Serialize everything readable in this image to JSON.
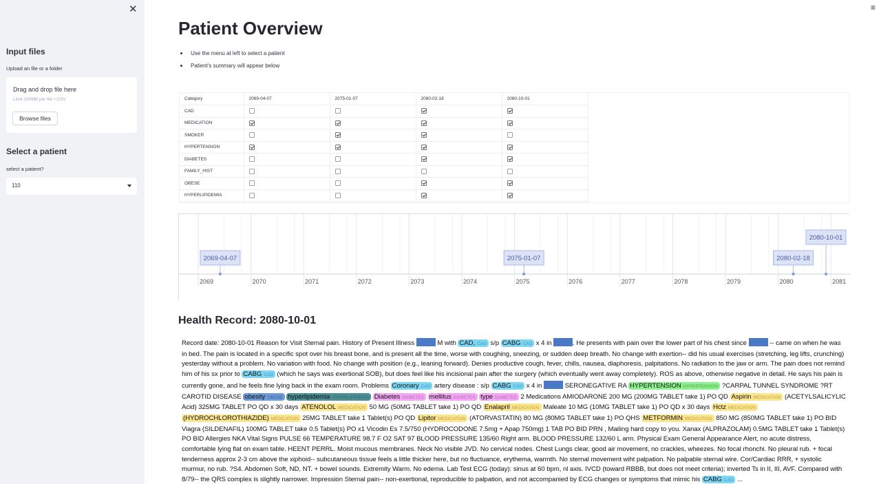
{
  "sidebar": {
    "input_files_title": "Input files",
    "upload_label": "Upload an file or a folder",
    "uploader_title": "Drag and drop file here",
    "uploader_limit": "Limit 200MB per file • CSV",
    "browse_label": "Browse files",
    "select_title": "Select a patient",
    "select_label": "select a patient?",
    "selected_patient": "110",
    "close_glyph": "✕"
  },
  "menu_glyph": "≡",
  "page": {
    "title": "Patient Overview",
    "bullets": [
      "Use the menu at left to select a patient",
      "Patient's summary will appear below"
    ]
  },
  "table": {
    "headers": [
      "Category",
      "2069-04-07",
      "2075-01-07",
      "2080-02-18",
      "2080-10-01"
    ],
    "rows": [
      {
        "category": "CAD",
        "values": [
          false,
          false,
          true,
          true
        ]
      },
      {
        "category": "MEDICATION",
        "values": [
          true,
          true,
          true,
          true
        ]
      },
      {
        "category": "SMOKER",
        "values": [
          false,
          true,
          true,
          false
        ]
      },
      {
        "category": "HYPERTENSION",
        "values": [
          true,
          true,
          true,
          true
        ]
      },
      {
        "category": "DIABETES",
        "values": [
          false,
          false,
          true,
          true
        ]
      },
      {
        "category": "FAMILY_HIST",
        "values": [
          false,
          false,
          false,
          false
        ]
      },
      {
        "category": "OBESE",
        "values": [
          false,
          false,
          true,
          true
        ]
      },
      {
        "category": "HYPERLIPIDEMIA",
        "values": [
          false,
          false,
          true,
          true
        ]
      }
    ]
  },
  "timeline": {
    "years": [
      "2069",
      "2070",
      "2071",
      "2072",
      "2073",
      "2074",
      "2075",
      "2076",
      "2077",
      "2078",
      "2079",
      "2080",
      "2081"
    ],
    "events": [
      {
        "label": "2069-04-07",
        "year": 2069.26
      },
      {
        "label": "2075-01-07",
        "year": 2075.02
      },
      {
        "label": "2080-02-18",
        "year": 2080.13
      },
      {
        "label": "2080-10-01",
        "year": 2080.75
      }
    ],
    "colors": {
      "box_fill": "#dde3f7",
      "box_stroke": "#aab8ec",
      "box_text": "#4a5aa8",
      "point": "#7e95e0"
    }
  },
  "record": {
    "title": "Health Record: 2080-10-01",
    "segments": [
      {
        "t": "Record date: 2080-10-01 Reason for Visit Sternal pain. History of Present Illness "
      },
      {
        "r": true
      },
      {
        "t": " M with "
      },
      {
        "e": "CAD,",
        "l": "CAD",
        "c": "cad"
      },
      {
        "t": " s/p "
      },
      {
        "e": "CABG",
        "l": "CAD",
        "c": "cad"
      },
      {
        "t": " x 4 in "
      },
      {
        "r": true
      },
      {
        "t": ". He presents with pain over the lower part of his chest since "
      },
      {
        "r": true
      },
      {
        "t": " -- came on when he was in bed. The pain is located in a specific spot over his breast bone, and is present all the time, worse with coughing, sneezing, or sudden deep breath. No change with exertion-- did his usual exercises (stretching, leg lifts, crunching) yesterday without a problem. No variation with food. No change with position (e.g., leaning forward). Denies productive cough, fever, chills, nausea, diaphoresis, palpitations. No radiation to the jaw or arm. The pain does not remind him of his sx prior to "
      },
      {
        "e": "CABG",
        "l": "CAD",
        "c": "cad"
      },
      {
        "t": " (which he says was exertional SOB), but does feel like his incisional pain after the surgery (which eventually went away completely). ROS as above, otherwise negative in detail. He says his pain is currently gone, and he feels fine lying back in the exam room. Problems "
      },
      {
        "e": "Coronary",
        "l": "CAD",
        "c": "cad"
      },
      {
        "t": " artery disease : s/p "
      },
      {
        "e": "CABG",
        "l": "CAD",
        "c": "cad"
      },
      {
        "t": " x 4 in "
      },
      {
        "r": true
      },
      {
        "t": " SERONEGATIVE RA "
      },
      {
        "e": "HYPERTENSION",
        "l": "HYPERTENSION",
        "c": "htn"
      },
      {
        "t": " ?CARPAL TUNNEL SYNDROME ?RT CAROTID DISEASE "
      },
      {
        "e": "obesity",
        "l": "OBESE",
        "c": "obese"
      },
      {
        "t": " "
      },
      {
        "e": "hyperlipidemia",
        "l": "HYPERLIPIDEMIA",
        "c": "hld"
      },
      {
        "t": " "
      },
      {
        "e": "Diabetes",
        "l": "DIABETES",
        "c": "dm"
      },
      {
        "t": " "
      },
      {
        "e": "mellitus",
        "l": "DIABETES",
        "c": "dm"
      },
      {
        "t": " "
      },
      {
        "e": "type",
        "l": "DIABETES",
        "c": "dm"
      },
      {
        "t": " 2 Medications AMIODARONE 200 MG (200MG TABLET take 1) PO QD "
      },
      {
        "e": "Aspirin",
        "l": "MEDICATION",
        "c": "med"
      },
      {
        "t": " (ACETYLSALICYLIC Acid) 325MG TABLET PO QD x 30 days "
      },
      {
        "e": "ATENOLOL",
        "l": "MEDICATION",
        "c": "med"
      },
      {
        "t": " 50 MG (50MG TABLET take 1) PO QD "
      },
      {
        "e": "Enalapril",
        "l": "MEDICATION",
        "c": "med"
      },
      {
        "t": " Maleate 10 MG (10MG TABLET take 1) PO QD x 30 days "
      },
      {
        "e": "Hctz",
        "l": "MEDICATION",
        "c": "med"
      },
      {
        "t": " "
      },
      {
        "e": "(HYDROCHLOROTHIAZIDE)",
        "l": "MEDICATION",
        "c": "med"
      },
      {
        "t": " 25MG TABLET take 1 Tablet(s) PO QD "
      },
      {
        "e": "Lipitor",
        "l": "MEDICATION",
        "c": "med"
      },
      {
        "t": " (ATORVASTATIN) 80 MG (80MG TABLET take 1) PO QHS "
      },
      {
        "e": "METFORMIN",
        "l": "MEDICATION",
        "c": "med"
      },
      {
        "t": " 850 MG (850MG TABLET take 1) PO BID Viagra (SILDENAFIL) 100MG TABLET take 0.5 Tablet(s) PO x1 Vicodin Es 7.5/750 (HYDROCODONE 7.5mg + Apap 750mg) 1 TAB PO BID PRN , Mailing hard copy to you. Xanax (ALPRAZOLAM) 0.5MG TABLET take 1 Tablet(s) PO BID Allergies NKA Vital Signs PULSE 66 TEMPERATURE 98.7 F O2 SAT 97 BLOOD PRESSURE 135/60 Right arm. BLOOD PRESSURE 132/60 L arm. Physical Exam General Appearance Alert, no acute distress, comfortable lying flat on exam table. HEENT PERRL. Moist mucous membranes. Neck No visible JVD. No cervical nodes. Chest Lungs clear, good air movement, no crackles, wheezes. No focal rhonchi. No pleural rub. + focal tenderness approx 2-3 cm above the xiphoid-- subcutaneous tissue feels a little thicker here, but no fluctuance, erythema, warmth. No sternal movement wiht palpation. No palpable sternal wire. Cor/Cardiac RRR, + systolic murmur, no rub. ?S4. Abdomen Soft, ND, NT. + bowel sounds. Extremity Warm. No edema. Lab Test ECG (today): sinus at 60 bpm, nl axis. IVCD (toward RBBB, but does not meet criteria); inverted Ts in II, III, AVF. Compared with 8/79-- the QRS complex is slightly narrower. Impression Sternal pain-- non-exertional, reproducible to palpation, and not accompanied by ECG changes or symptoms that mimic his "
      },
      {
        "e": "CABG",
        "l": "CAD",
        "c": "cad"
      },
      {
        "t": " ..."
      }
    ],
    "entity_colors": {
      "cad": {
        "bg": "#7fd6f2",
        "label": "#3b8fb0"
      },
      "htn": {
        "bg": "#8ef08e",
        "label": "#3d9a3d"
      },
      "obese": {
        "bg": "#6f9ad8",
        "label": "#2f5a98"
      },
      "hld": {
        "bg": "#4e8f96",
        "label": "#2b6167"
      },
      "dm": {
        "bg": "#f2a7f2",
        "label": "#b55eb5"
      },
      "med": {
        "bg": "#fbe58e",
        "label": "#b2962d"
      },
      "redact": "#4a79c7"
    }
  }
}
